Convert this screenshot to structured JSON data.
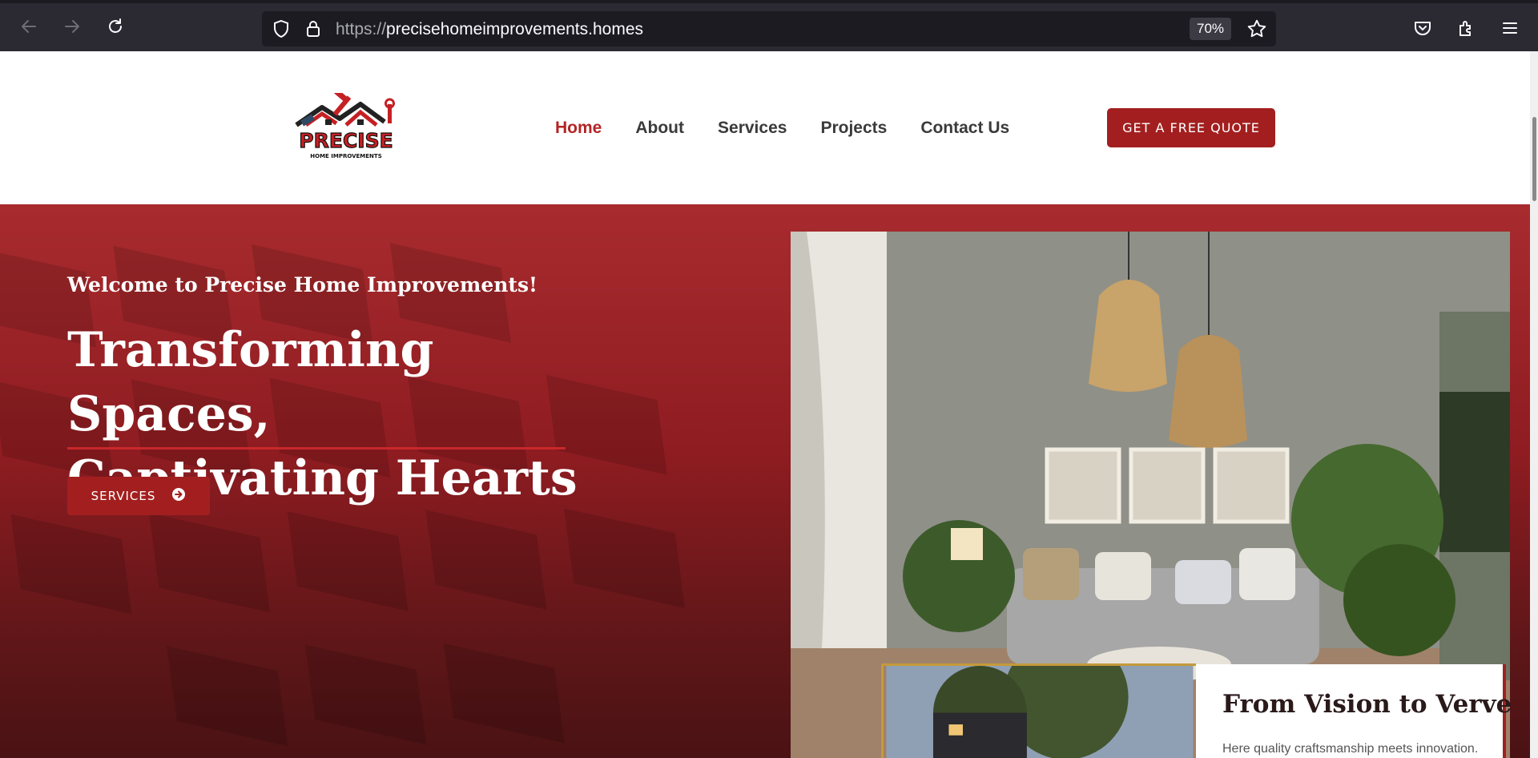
{
  "browser": {
    "url_protocol": "https://",
    "url_host": "precisehomeimprovements.homes",
    "zoom": "70%"
  },
  "header": {
    "logo_text": "PRECISE",
    "logo_subtext": "HOME IMPROVEMENTS",
    "nav": [
      "Home",
      "About",
      "Services",
      "Projects",
      "Contact Us"
    ],
    "cta_label": "GET A FREE QUOTE"
  },
  "hero": {
    "welcome": "Welcome to Precise Home Improvements!",
    "headline_line1": "Transforming Spaces,",
    "headline_line2": "Captivating Hearts",
    "button_label": "SERVICES"
  },
  "card": {
    "title": "From Vision to Verve",
    "text": "Here quality craftsmanship meets innovation."
  },
  "colors": {
    "brand_red": "#a31f1f",
    "nav_active": "#b32424",
    "chrome_bg": "#2b2a33"
  },
  "icons": [
    "back-arrow-icon",
    "forward-arrow-icon",
    "reload-icon",
    "shield-icon",
    "lock-icon",
    "star-icon",
    "pocket-icon",
    "extensions-icon",
    "menu-icon",
    "circle-arrow-right-icon"
  ]
}
